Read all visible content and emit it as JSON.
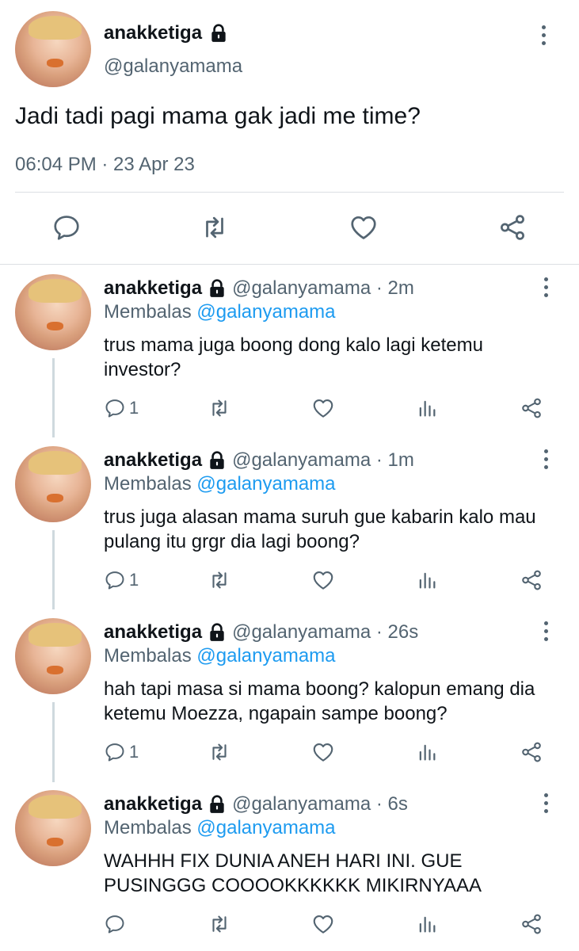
{
  "main_tweet": {
    "display_name": "anakketiga",
    "handle": "@galanyamama",
    "text": "Jadi tadi pagi mama gak jadi me time?",
    "timestamp": "06:04 PM · 23 Apr 23"
  },
  "replies": [
    {
      "display_name": "anakketiga",
      "meta": "@galanyamama · 2m",
      "replying_to_label": "Membalas",
      "replying_to_handle": "@galanyamama",
      "text": "trus mama juga boong dong kalo lagi ketemu investor?",
      "reply_count": "1"
    },
    {
      "display_name": "anakketiga",
      "meta": "@galanyamama · 1m",
      "replying_to_label": "Membalas",
      "replying_to_handle": "@galanyamama",
      "text": "trus juga alasan mama suruh gue kabarin kalo mau pulang itu grgr dia lagi boong?",
      "reply_count": "1"
    },
    {
      "display_name": "anakketiga",
      "meta": "@galanyamama · 26s",
      "replying_to_label": "Membalas",
      "replying_to_handle": "@galanyamama",
      "text": "hah tapi masa si mama boong? kalopun emang dia ketemu Moezza, ngapain sampe boong?",
      "reply_count": "1"
    },
    {
      "display_name": "anakketiga",
      "meta": "@galanyamama · 6s",
      "replying_to_label": "Membalas",
      "replying_to_handle": "@galanyamama",
      "text": "WAHHH FIX DUNIA ANEH HARI INI. GUE PUSINGGG COOOOKKKKKK MIKIRNYAAA",
      "reply_count": ""
    }
  ],
  "colors": {
    "text": "#0f1419",
    "secondary": "#536471",
    "link": "#1d9bf0",
    "divider": "#dcdfe3"
  },
  "icons": [
    "lock-icon",
    "more-icon",
    "reply-icon",
    "retweet-icon",
    "like-icon",
    "share-icon",
    "views-icon"
  ]
}
